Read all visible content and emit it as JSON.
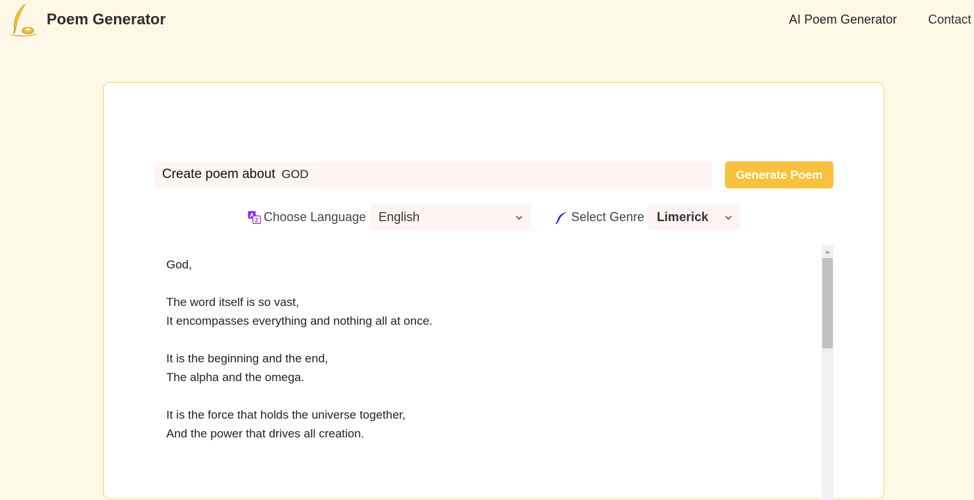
{
  "header": {
    "brand": "Poem Generator",
    "logo_icon": "quill-ink-icon",
    "nav": [
      {
        "label": "AI Poem Generator"
      },
      {
        "label": "Contact"
      }
    ]
  },
  "form": {
    "prompt_label": "Create poem about",
    "prompt_value": "GOD",
    "generate_label": "Generate Poem",
    "language_icon": "translate-icon",
    "language_label": "Choose Language",
    "language_value": "English",
    "genre_icon": "feather-icon",
    "genre_label": "Select Genre",
    "genre_value": "Limerick"
  },
  "poem": {
    "lines": [
      "God,",
      "",
      "The word itself is so vast,",
      "It encompasses everything and nothing all at once.",
      "",
      "It is the beginning and the end,",
      "The alpha and the omega.",
      "",
      "It is the force that holds the universe together,",
      "And the power that drives all creation."
    ]
  },
  "colors": {
    "background": "#fff8e6",
    "accent": "#f7c23c",
    "card_border": "#f3d27a",
    "field_bg": "#fff4f4",
    "translate_icon": "#8a2be2",
    "feather_icon": "#1a1aff"
  }
}
